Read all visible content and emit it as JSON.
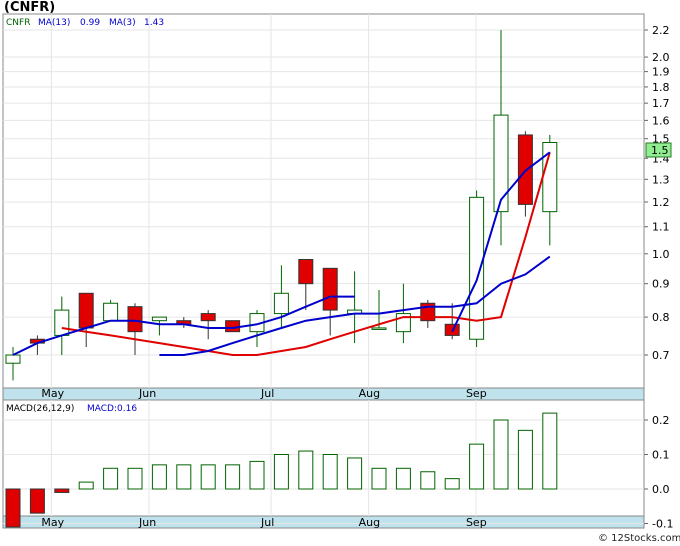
{
  "title": "(CNFR)",
  "footer": "© 12Stocks.com",
  "colors": {
    "up": "#006400",
    "down": "#e00000",
    "ma_short": "#e00000",
    "ma_long": "#0000cc",
    "macd": "#006400",
    "axis_band": "#bfe2ec",
    "badge": "#90ee90",
    "legend_ticker": "#006400",
    "legend_ma": "#0000cc"
  },
  "legend": {
    "ticker": "CNFR",
    "ma13": "MA(13)",
    "ma13_val": "0.99",
    "ma3": "MA(3)",
    "ma3_val": "1.43"
  },
  "macd_legend": {
    "label": "MACD(26,12,9)",
    "val": "MACD:0.16"
  },
  "last_price_badge": "1.5",
  "chart_data": [
    {
      "type": "candlestick",
      "title": "(CNFR)",
      "y_scale": "log",
      "ylim": [
        0.6,
        2.3
      ],
      "y_ticks": [
        "0.7",
        "0.8",
        "0.9",
        "1.0",
        "1.1",
        "1.2",
        "1.3",
        "1.4",
        "1.5",
        "1.6",
        "1.7",
        "1.8",
        "1.9",
        "2.0",
        "2.2"
      ],
      "x_labels": [
        "May",
        "Jun",
        "Jul",
        "Aug",
        "Sep"
      ],
      "candles": [
        {
          "o": 0.68,
          "h": 0.72,
          "l": 0.64,
          "c": 0.7
        },
        {
          "o": 0.74,
          "h": 0.75,
          "l": 0.7,
          "c": 0.73
        },
        {
          "o": 0.75,
          "h": 0.86,
          "l": 0.7,
          "c": 0.82
        },
        {
          "o": 0.87,
          "h": 0.87,
          "l": 0.72,
          "c": 0.77
        },
        {
          "o": 0.79,
          "h": 0.85,
          "l": 0.79,
          "c": 0.84
        },
        {
          "o": 0.83,
          "h": 0.84,
          "l": 0.7,
          "c": 0.76
        },
        {
          "o": 0.79,
          "h": 0.8,
          "l": 0.75,
          "c": 0.8
        },
        {
          "o": 0.79,
          "h": 0.8,
          "l": 0.77,
          "c": 0.78
        },
        {
          "o": 0.81,
          "h": 0.82,
          "l": 0.74,
          "c": 0.79
        },
        {
          "o": 0.79,
          "h": 0.79,
          "l": 0.76,
          "c": 0.76
        },
        {
          "o": 0.76,
          "h": 0.82,
          "l": 0.72,
          "c": 0.81
        },
        {
          "o": 0.81,
          "h": 0.96,
          "l": 0.77,
          "c": 0.87
        },
        {
          "o": 0.98,
          "h": 0.98,
          "l": 0.82,
          "c": 0.9
        },
        {
          "o": 0.95,
          "h": 0.95,
          "l": 0.75,
          "c": 0.82
        },
        {
          "o": 0.81,
          "h": 0.94,
          "l": 0.73,
          "c": 0.82
        },
        {
          "o": 0.77,
          "h": 0.88,
          "l": 0.77,
          "c": 0.77
        },
        {
          "o": 0.76,
          "h": 0.9,
          "l": 0.73,
          "c": 0.81
        },
        {
          "o": 0.84,
          "h": 0.85,
          "l": 0.77,
          "c": 0.79
        },
        {
          "o": 0.78,
          "h": 0.84,
          "l": 0.74,
          "c": 0.75
        },
        {
          "o": 0.74,
          "h": 1.25,
          "l": 0.72,
          "c": 1.22
        },
        {
          "o": 1.16,
          "h": 2.2,
          "l": 1.03,
          "c": 1.63
        },
        {
          "o": 1.52,
          "h": 1.54,
          "l": 1.14,
          "c": 1.19
        },
        {
          "o": 1.16,
          "h": 1.52,
          "l": 1.03,
          "c": 1.48
        }
      ],
      "ma3": [
        null,
        null,
        0.77,
        0.76,
        0.75,
        0.74,
        0.73,
        0.72,
        0.71,
        0.7,
        0.7,
        0.71,
        0.72,
        0.74,
        0.76,
        0.78,
        0.8,
        0.8,
        0.8,
        0.79,
        0.8,
        1.06,
        1.43
      ],
      "ma13": [
        0.7,
        0.73,
        0.75,
        0.77,
        0.79,
        0.79,
        0.78,
        0.78,
        0.77,
        0.77,
        0.78,
        0.8,
        0.83,
        0.86,
        0.86,
        null,
        null,
        null,
        null,
        null,
        null,
        null,
        null
      ],
      "ma13b": [
        null,
        null,
        null,
        null,
        null,
        null,
        0.7,
        0.7,
        0.71,
        0.73,
        0.75,
        0.77,
        0.79,
        0.8,
        0.81,
        0.81,
        0.82,
        0.83,
        0.83,
        0.84,
        0.9,
        0.93,
        0.99
      ],
      "ma3b": [
        null,
        null,
        null,
        null,
        null,
        null,
        null,
        null,
        null,
        null,
        null,
        null,
        null,
        null,
        null,
        null,
        null,
        null,
        0.76,
        0.91,
        1.21,
        1.34,
        1.43
      ]
    },
    {
      "type": "bar",
      "title": "MACD(26,12,9)",
      "ylim": [
        -0.12,
        0.25
      ],
      "y_ticks": [
        "0.2",
        "0.1",
        "0.0",
        "-0.1"
      ],
      "x_labels": [
        "May",
        "Jun",
        "Jul",
        "Aug",
        "Sep"
      ],
      "values": [
        -0.11,
        -0.07,
        -0.01,
        0.02,
        0.06,
        0.06,
        0.07,
        0.07,
        0.07,
        0.07,
        0.08,
        0.1,
        0.11,
        0.1,
        0.09,
        0.06,
        0.06,
        0.05,
        0.03,
        0.13,
        0.2,
        0.17,
        0.22
      ]
    }
  ]
}
